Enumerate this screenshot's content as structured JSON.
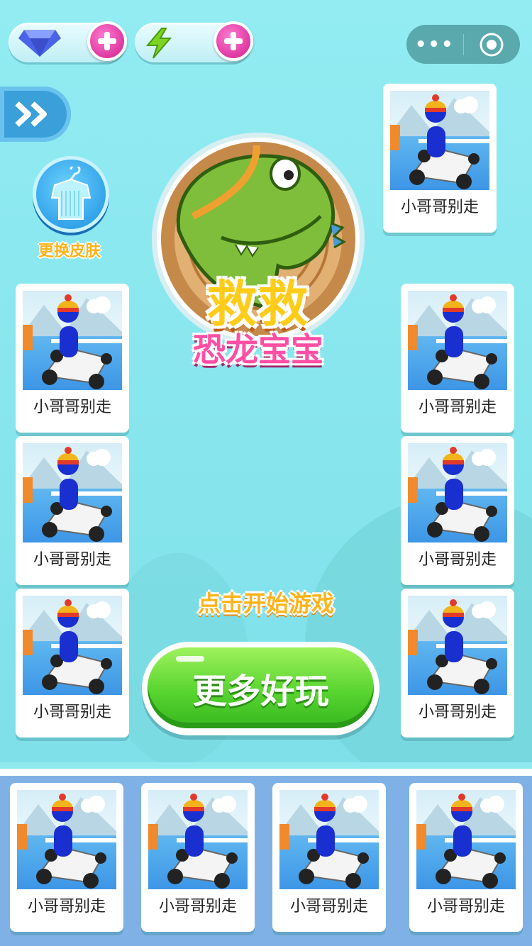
{
  "header": {
    "gem_label": "",
    "energy_label": ""
  },
  "sidebar": {
    "skin_button_label": "更换皮肤"
  },
  "logo": {
    "title_line1": "救救",
    "title_line2": "恐龙宝宝"
  },
  "main": {
    "start_text": "点击开始游戏",
    "more_button_label": "更多好玩"
  },
  "side_cards": [
    {
      "name": "小哥哥别走"
    },
    {
      "name": "小哥哥别走"
    },
    {
      "name": "小哥哥别走"
    },
    {
      "name": "小哥哥别走"
    },
    {
      "name": "小哥哥别走"
    },
    {
      "name": "小哥哥别走"
    },
    {
      "name": "小哥哥别走"
    }
  ],
  "bottom_cards": [
    {
      "name": "小哥哥别走"
    },
    {
      "name": "小哥哥别走"
    },
    {
      "name": "小哥哥别走"
    },
    {
      "name": "小哥哥别走"
    }
  ],
  "colors": {
    "background": "#8fe9ef",
    "accent_pink": "#d01d8d",
    "button_green": "#58d430",
    "label_orange": "#ffb31a",
    "bottom_bar": "#7fb1e6"
  }
}
